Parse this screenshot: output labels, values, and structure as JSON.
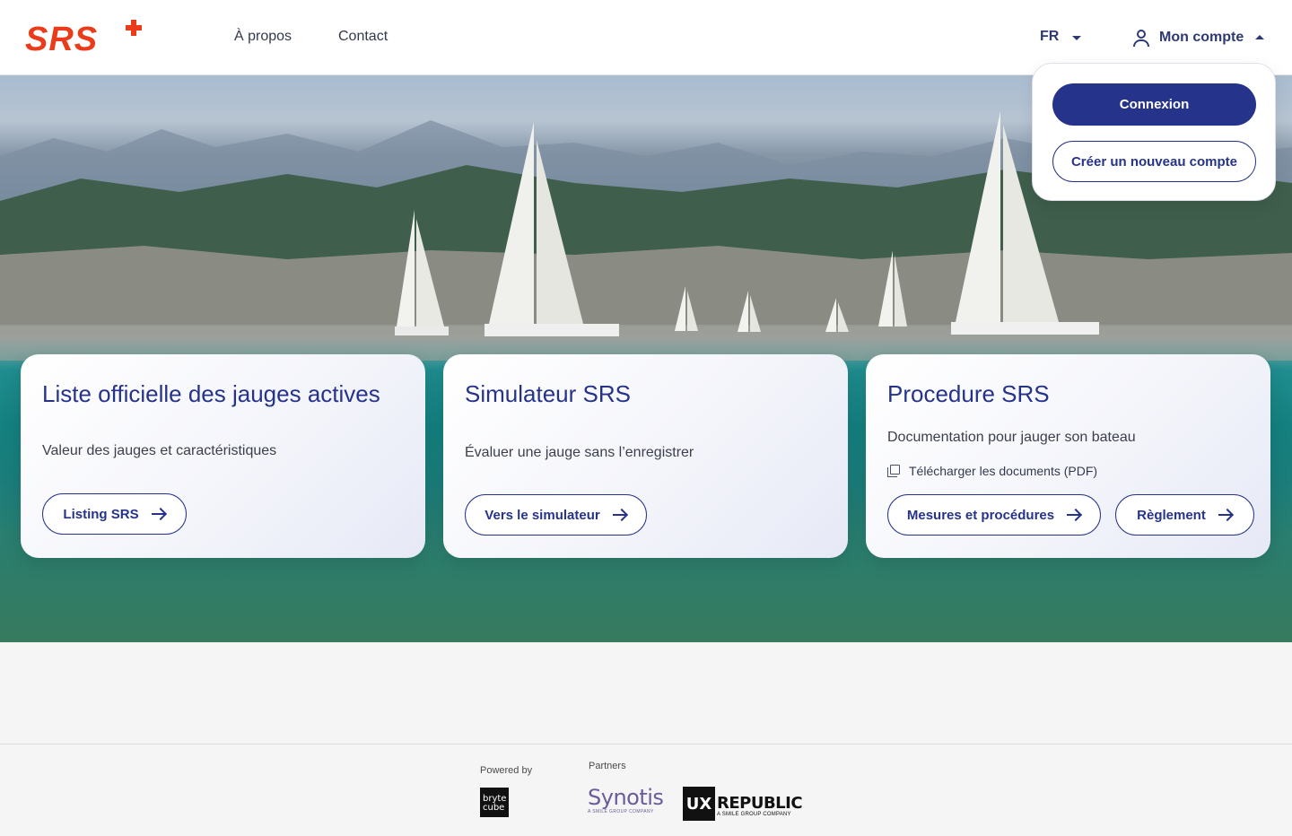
{
  "header": {
    "logo_text": "SRS",
    "nav": [
      {
        "label": "À propos"
      },
      {
        "label": "Contact"
      }
    ],
    "language": "FR",
    "account_label": "Mon compte"
  },
  "account_menu": {
    "login_label": "Connexion",
    "register_label": "Créer un nouveau compte"
  },
  "cards": [
    {
      "title": "Liste officielle des jauges actives",
      "subtitle": "Valeur des jauges et caractéristiques",
      "button": "Listing SRS"
    },
    {
      "title": "Simulateur SRS",
      "subtitle": "Évaluer une jauge sans l’enregistrer",
      "button": "Vers le simulateur"
    },
    {
      "title": "Procedure SRS",
      "subtitle": "Documentation pour jauger son bateau",
      "download_link": "Télécharger les documents (PDF)",
      "button": "Mesures et procédures",
      "button2": "Règlement"
    }
  ],
  "footer": {
    "powered_by": "Powered by",
    "partners": "Partners",
    "brytecube_logo": "bryte cube",
    "synotis_logo": "Synotis",
    "synotis_tagline": "A SMILE GROUP COMPANY",
    "uxrepublic_logo_ux": "UX",
    "uxrepublic_logo_name": "REPUBLIC",
    "uxrepublic_tagline": "A SMILE GROUP COMPANY"
  },
  "colors": {
    "brand_red": "#ea3b1a",
    "primary_blue": "#26338a",
    "nav_text": "#333a4d"
  },
  "icons": [
    "user-icon",
    "caret-down-icon",
    "caret-up-icon",
    "arrow-right-icon",
    "document-icon",
    "swiss-cross-icon"
  ]
}
